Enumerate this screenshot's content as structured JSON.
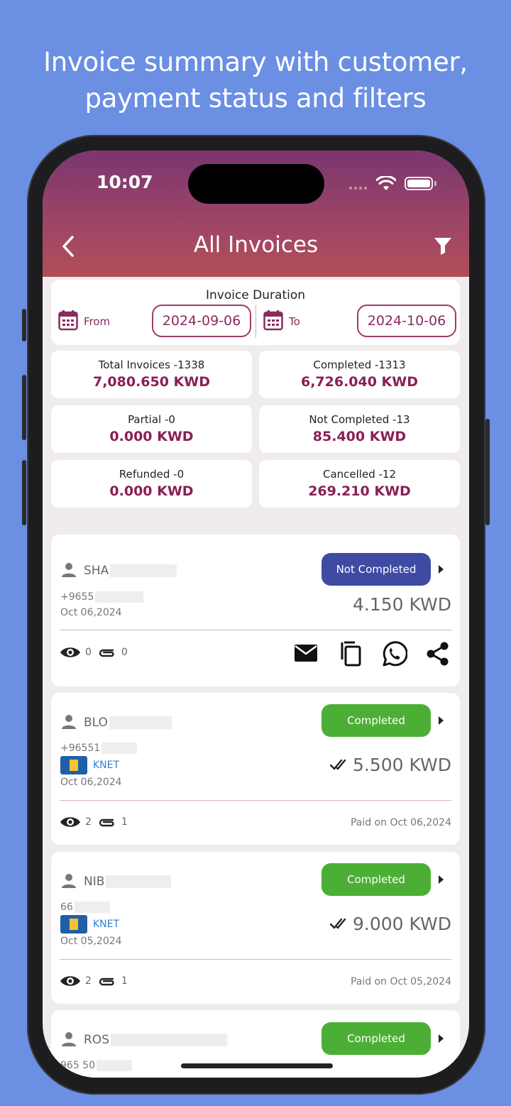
{
  "promo": {
    "line1": "Invoice summary with customer,",
    "line2": "payment status and filters"
  },
  "status_bar": {
    "time": "10:07"
  },
  "header": {
    "title": "All Invoices"
  },
  "duration": {
    "label": "Invoice Duration",
    "from_label": "From",
    "from_value": "2024-09-06",
    "to_label": "To",
    "to_value": "2024-10-06"
  },
  "stats": [
    {
      "label": "Total Invoices -1338",
      "value": "7,080.650 KWD"
    },
    {
      "label": "Completed -1313",
      "value": "6,726.040 KWD"
    },
    {
      "label": "Partial -0",
      "value": "0.000 KWD"
    },
    {
      "label": "Not Completed -13",
      "value": "85.400 KWD"
    },
    {
      "label": "Refunded -0",
      "value": "0.000 KWD"
    },
    {
      "label": "Cancelled -12",
      "value": "269.210 KWD"
    }
  ],
  "invoices": [
    {
      "name": "SHA",
      "phone": "+9655",
      "date": "Oct 06,2024",
      "amount": "4.150 KWD",
      "status": "Not Completed",
      "status_color": "#3f4aa3",
      "views": "0",
      "attachments": "0"
    },
    {
      "name": "BLO",
      "phone": "+96551",
      "method": "KNET",
      "date": "Oct 06,2024",
      "amount": "5.500 KWD",
      "status": "Completed",
      "status_color": "#4caf35",
      "views": "2",
      "attachments": "1",
      "paid": "Paid on Oct 06,2024"
    },
    {
      "name": "NIB",
      "phone": "66",
      "method": "KNET",
      "date": "Oct 05,2024",
      "amount": "9.000 KWD",
      "status": "Completed",
      "status_color": "#4caf35",
      "views": "2",
      "attachments": "1",
      "paid": "Paid on Oct 05,2024"
    },
    {
      "name": "ROS",
      "phone": "965 50",
      "status": "Completed",
      "status_color": "#4caf35"
    }
  ]
}
